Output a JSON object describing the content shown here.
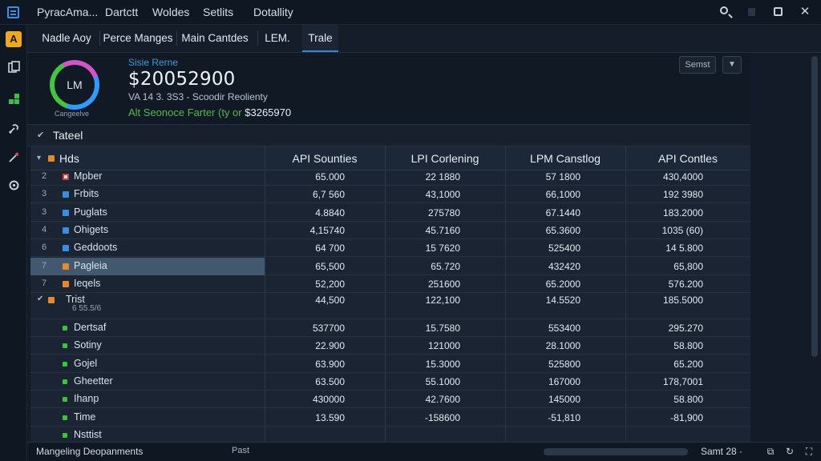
{
  "menu": [
    "PyracAma...",
    "Dartctt",
    "Woldes",
    "Setlits",
    "Dotallity"
  ],
  "tabs": [
    {
      "label": "Nadle Aoy",
      "active": false
    },
    {
      "label": "Perce Manges",
      "active": false
    },
    {
      "label": "Main Cantdes",
      "active": false
    },
    {
      "label": "LEM.",
      "active": false
    },
    {
      "label": "Trale",
      "active": true
    }
  ],
  "summary": {
    "ring_text": "LM",
    "ring_caption": "Cangeelve",
    "label": "Sisie Rerne",
    "value": "$20052900",
    "sub": "VA 14 3. 3S3 - Scoodir Reolienty",
    "note_prefix": "Alt Seonoce Farter (ty or",
    "note_value": "$3265970",
    "sort_label": "Semst"
  },
  "section": {
    "title": "Tateel"
  },
  "table": {
    "group_label": "Hds",
    "columns": [
      "API Sounties",
      "LPI Corlening",
      "LPM Canstlog",
      "API Contles"
    ],
    "rows": [
      {
        "num": "2",
        "name": "Mpber",
        "color": "#e8e8e8",
        "marker": "sq-red",
        "v": [
          "65.000",
          "22 1880",
          "57 1800",
          "430,4000"
        ]
      },
      {
        "num": "3",
        "name": "Frbits",
        "color": "#3a8ee0",
        "marker": "sq",
        "v": [
          "6,7 560",
          "43,1000",
          "66,1000",
          "192 3980"
        ]
      },
      {
        "num": "3",
        "name": "Puglats",
        "color": "#3a8ee0",
        "marker": "sq",
        "v": [
          "4.8840",
          "275780",
          "67.1440",
          "183.2000"
        ]
      },
      {
        "num": "4",
        "name": "Ohigets",
        "color": "#3a8ee0",
        "marker": "sq",
        "v": [
          "4,15740",
          "45.7160",
          "65.3600",
          "1035 (60)"
        ]
      },
      {
        "num": "6",
        "name": "Geddoots",
        "color": "#3a8ee0",
        "marker": "sq",
        "v": [
          "64 700",
          "15 7620",
          "525400",
          "14 5.800"
        ]
      },
      {
        "num": "7",
        "name": "Pagleia",
        "color": "#e48a2c",
        "marker": "sq",
        "v": [
          "65,500",
          "65.720",
          "432420",
          "65,800"
        ]
      },
      {
        "num": "7",
        "name": "Ieqels",
        "color": "#e48a2c",
        "marker": "sq",
        "v": [
          "52,200",
          "251600",
          "65.2000",
          "576.200"
        ]
      }
    ],
    "group2": {
      "name": "Trist",
      "sub": "6 55.5/6",
      "v": [
        "44,500",
        "122,100",
        "14.5520",
        "185.5000"
      ]
    },
    "subrows": [
      {
        "name": "Dertsaf",
        "v": [
          "537700",
          "15.7580",
          "553400",
          "295.270"
        ]
      },
      {
        "name": "Sotiny",
        "v": [
          "22.900",
          "121000",
          "28.1000",
          "58.800"
        ]
      },
      {
        "name": "Gojel",
        "v": [
          "63.900",
          "15.3000",
          "525800",
          "65.200"
        ]
      },
      {
        "name": "Gheetter",
        "v": [
          "63.500",
          "55.1000",
          "167000",
          "178,7001"
        ]
      },
      {
        "name": "Ihanp",
        "v": [
          "430000",
          "42.7600",
          "145000",
          "58.800"
        ]
      },
      {
        "name": "Time",
        "v": [
          "13.590",
          "-158600",
          "-51,810",
          "-81,900"
        ]
      },
      {
        "name": "Nsttist",
        "v": [
          "",
          "",
          "",
          ""
        ]
      }
    ]
  },
  "status": {
    "left": "Mangeling Deopanments",
    "mid": "Past",
    "right": "Samt 28 ·"
  }
}
